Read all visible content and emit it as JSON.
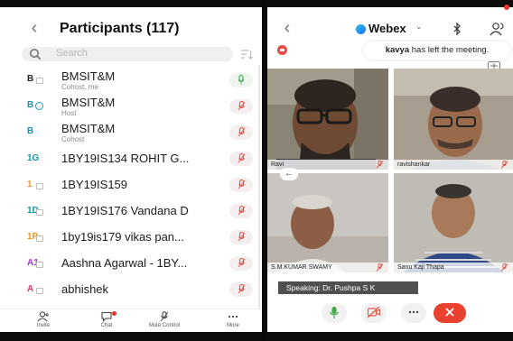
{
  "participants_panel": {
    "title": "Participants (117)",
    "search_placeholder": "Search",
    "participants": [
      {
        "initials": "B",
        "initials_color": "#222222",
        "name": "BMSIT&M",
        "role": "Cohost, me",
        "mic": "on"
      },
      {
        "initials": "B",
        "initials_color": "#1592a8",
        "name": "BMSIT&M",
        "role": "Host",
        "mic": "muted"
      },
      {
        "initials": "B",
        "initials_color": "#1592a8",
        "name": "BMSIT&M",
        "role": "Cohost",
        "mic": "muted"
      },
      {
        "initials": "1G",
        "initials_color": "#1592a8",
        "name": "1BY19IS134 ROHIT G...",
        "role": "",
        "mic": "muted"
      },
      {
        "initials": "1",
        "initials_color": "#e8962c",
        "name": "1BY19IS159",
        "role": "",
        "mic": "muted"
      },
      {
        "initials": "1D",
        "initials_color": "#1592a8",
        "name": "1BY19IS176 Vandana D",
        "role": "",
        "mic": "muted"
      },
      {
        "initials": "1P",
        "initials_color": "#e8962c",
        "name": "1by19is179 vikas pan...",
        "role": "",
        "mic": "muted"
      },
      {
        "initials": "A1",
        "initials_color": "#9b3fc6",
        "name": "Aashna Agarwal - 1BY...",
        "role": "",
        "mic": "muted"
      },
      {
        "initials": "A",
        "initials_color": "#d83b6a",
        "name": "abhishek",
        "role": "",
        "mic": "muted"
      }
    ],
    "tabs": [
      {
        "label": "Invite",
        "icon": "invite-icon"
      },
      {
        "label": "Chat",
        "icon": "chat-icon"
      },
      {
        "label": "Mute Control",
        "icon": "mute-control-icon"
      },
      {
        "label": "More",
        "icon": "more-icon"
      }
    ]
  },
  "meeting_panel": {
    "app_name": "Webex",
    "notification": {
      "user": "kavya",
      "message": "has left the meeting."
    },
    "video_tiles": [
      {
        "name": "Ravi",
        "mic": "muted"
      },
      {
        "name": "ravishankar",
        "mic": "muted"
      },
      {
        "name": "S.M.KUMAR SWAMY",
        "mic": "muted"
      },
      {
        "name": "Sanu Kaji Thapa",
        "mic": "muted"
      }
    ],
    "speaking_text": "Speaking: Dr. Pushpa S K",
    "controls": [
      {
        "name": "mute-mic",
        "icon": "microphone-icon"
      },
      {
        "name": "video-off",
        "icon": "video-off-icon"
      },
      {
        "name": "more",
        "icon": "more-icon"
      },
      {
        "name": "end-call",
        "icon": "close-icon"
      }
    ]
  },
  "colors": {
    "accent_red": "#e8412f",
    "mic_on_green": "#3ea84a",
    "mic_muted_red": "#e2574c",
    "webex_blue": "#2a6ef0"
  }
}
